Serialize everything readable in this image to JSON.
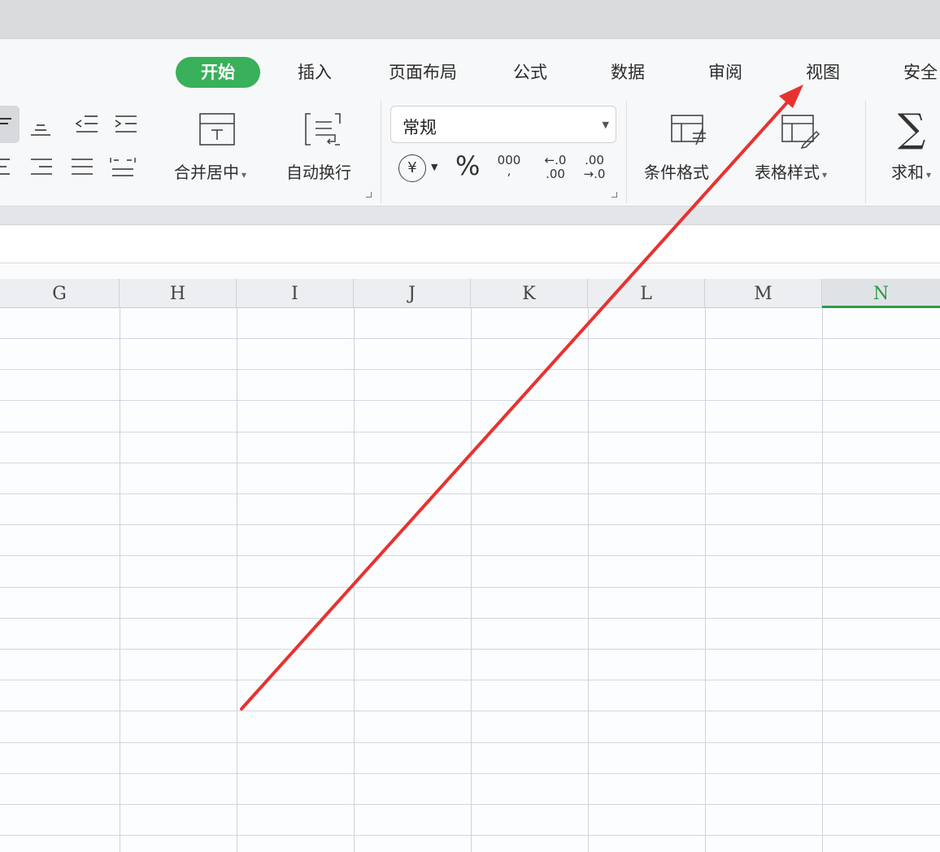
{
  "tabs": [
    {
      "label": "开始",
      "active": true
    },
    {
      "label": "插入"
    },
    {
      "label": "页面布局"
    },
    {
      "label": "公式"
    },
    {
      "label": "数据"
    },
    {
      "label": "审阅"
    },
    {
      "label": "视图"
    },
    {
      "label": "安全"
    }
  ],
  "ribbon": {
    "merge_label": "合并居中",
    "wrap_label": "自动换行",
    "number_format_value": "常规",
    "conditional_format_label": "条件格式",
    "table_style_label": "表格样式",
    "sum_label": "求和",
    "currency_symbol": "¥",
    "percent_symbol": "%",
    "thousands_top": "000",
    "thousands_bottom": ",",
    "dec_increase_top": "←.0",
    "dec_increase_bottom": ".00",
    "dec_decrease_top": ".00",
    "dec_decrease_bottom": "→.0",
    "sum_symbol": "∑"
  },
  "columns": [
    {
      "label": "G"
    },
    {
      "label": "H"
    },
    {
      "label": "I"
    },
    {
      "label": "J"
    },
    {
      "label": "K"
    },
    {
      "label": "L"
    },
    {
      "label": "M"
    },
    {
      "label": "N",
      "selected": true
    }
  ],
  "colors": {
    "accent": "#39b05a",
    "arrow": "#e8322f"
  },
  "annotation": {
    "type": "red-arrow",
    "points_to": "视图"
  }
}
